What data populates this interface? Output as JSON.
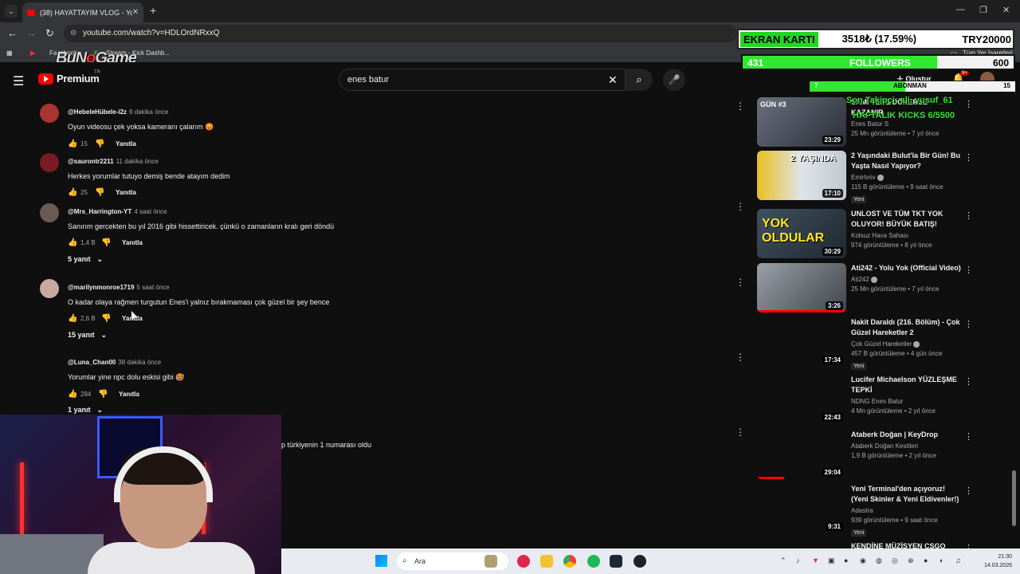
{
  "browser": {
    "tab_title": "(38) HAYATTAYIM VLOG - YouTube",
    "url": "youtube.com/watch?v=HDLOrdNRxxQ",
    "bookmarks": [
      "Facebook",
      "Stream - Kick Dashb...",
      "Tüm Yer İşaretleri"
    ]
  },
  "watermark": {
    "prefix": "BuN",
    "o": "o",
    "suffix": "Game"
  },
  "youtube": {
    "brand": "Premium",
    "region": "TR",
    "search_value": "enes batur",
    "create_label": "Oluştur",
    "notification_count": "9+"
  },
  "comments": [
    {
      "author": "@HebeleHübele-i2z",
      "time": "9 dakika önce",
      "text": "Oyun videosu çek yoksa kameranı çalarım 😡",
      "likes": "15",
      "reply_label": "Yanıtla"
    },
    {
      "author": "@saurontr2211",
      "time": "11 dakika önce",
      "text": "Herkes yorumlar tutuyo demiş bende atayım dedim",
      "likes": "25",
      "reply_label": "Yanıtla"
    },
    {
      "author": "@Mrs_Harrington-YT",
      "time": "4 saat önce",
      "text": "Sanırım gercekten bu yıl 2016 gibi hissettiricek. çünkü o zamanların kralı geri döndü",
      "likes": "1,4 B",
      "reply_label": "Yanıtla",
      "replies": "5 yanıt"
    },
    {
      "author": "@marilynmonroe1719",
      "time": "5 saat önce",
      "text": "O kadar olaya rağmen turgutun Enes'i yalnız bırakmaması çok güzel bir şey bence",
      "likes": "2,6 B",
      "reply_label": "Yanıtla",
      "replies": "15 yanıt"
    },
    {
      "author": "@Luna_Chan00",
      "time": "38 dakika önce",
      "text": "Yorumlar yine npc dolu eskisi gibi 🥵",
      "likes": "284",
      "reply_label": "Yanıtla",
      "replies": "1 yanıt"
    }
  ],
  "truncated_comment": "p türkiyenin 1 numarası oldu",
  "sidebar": [
    {
      "title": "SAMİ TERS DÖNERSE KAZANIR",
      "channel": "Enes Batur S",
      "meta": "25 Mn görüntüleme • 7 yıl önce",
      "duration": "23:29",
      "thumb_text": "GÜN #3"
    },
    {
      "title": "2 Yaşındaki Bulut'la Bir Gün! Bu Yaşta Nasıl Yapıyor?",
      "channel": "Emirlvriv",
      "verified": true,
      "meta": "115 B görüntüleme • 9 saat önce",
      "badge": "Yeni",
      "duration": "17:10",
      "thumb_text": "2 YAŞINDA"
    },
    {
      "title": "UNLOST VE TÜM TKT YOK OLUYOR! BÜYÜK BATIŞ!",
      "channel": "Kolsuz Hava Sahası",
      "meta": "974 görüntüleme • 8 yıl önce",
      "duration": "30:29",
      "thumb_text": "YOK OLDULAR"
    },
    {
      "title": "Ati242 - Yolu Yok (Official Video)",
      "channel": "Ati242",
      "verified": true,
      "meta": "25 Mn görüntüleme • 7 yıl önce",
      "duration": "3:26"
    },
    {
      "title": "Nakit Daraldı (216. Bölüm) - Çok Güzel Hareketler 2",
      "channel": "Çok Güzel Hareketler",
      "verified": true,
      "meta": "457 B görüntüleme • 4 gün önce",
      "badge": "Yeni",
      "duration": "17:34"
    },
    {
      "title": "Lucifer Michaelson YÜZLEŞME TEPKİ",
      "channel": "NDNG Enes Batur",
      "meta": "4 Mn görüntüleme • 2 yıl önce",
      "duration": "22:43"
    },
    {
      "title": "Ataberk Doğan | KeyDrop",
      "channel": "Ataberk Doğan Kesitleri",
      "meta": "1,9 B görüntüleme • 2 yıl önce",
      "duration": "29:04"
    },
    {
      "title": "Yeni Terminal'den açıyoruz! (Yeni Skinler & Yeni Eldivenler!)",
      "channel": "Adastra",
      "meta": "939 görüntüleme • 9 saat önce",
      "badge": "Yeni",
      "duration": "9:31"
    },
    {
      "title": "KENDİNE MÜZİSYEN CSGO",
      "channel": "",
      "meta": ""
    }
  ],
  "overlay": {
    "ekran_karti": "EKRAN KARTI",
    "price": "3518₺ (17.59%)",
    "target": "TRY20000",
    "followers_current": "431",
    "followers_label": "FOLLOWERS",
    "followers_goal": "600",
    "followers_progress": 0.7183,
    "sub_current": "7",
    "sub_label": "ABONMAN",
    "sub_goal": "15",
    "sub_progress": 0.4667,
    "tip_line": "Son Takipçi: ali_yusuf_61",
    "kicks_line": "HAFTALIK KICKS 6/5500"
  },
  "taskbar": {
    "search_placeholder": "Ara",
    "time": "21:30",
    "date": "14.03.2026"
  }
}
